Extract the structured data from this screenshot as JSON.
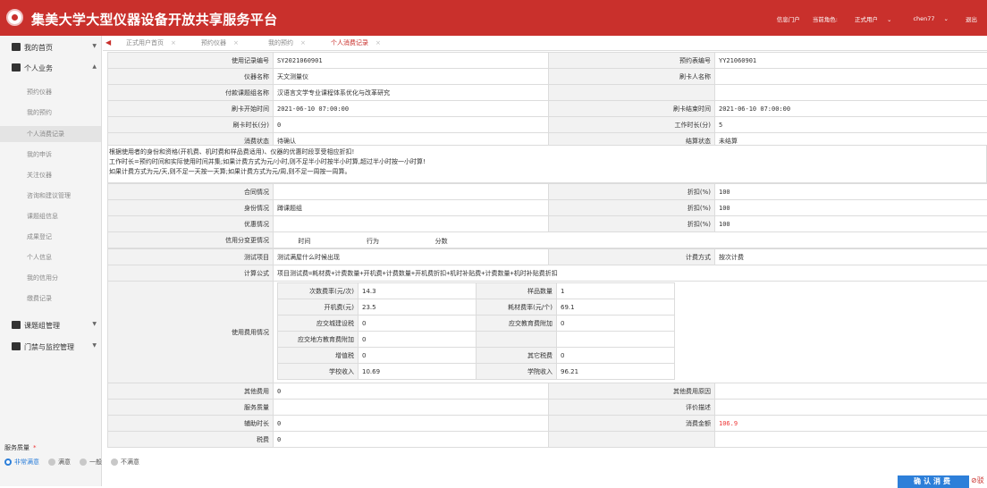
{
  "app": {
    "title": "集美大学大型仪器设备开放共享服务平台"
  },
  "topnav": {
    "portal": "信息门户",
    "role_label": "当前角色:",
    "role": "正式用户",
    "user": "chen77",
    "logout": "退出"
  },
  "sidebar": {
    "home": "我的首页",
    "personal": "个人业务",
    "personal_items": [
      "预约仪器",
      "我的预约",
      "个人消费记录",
      "我的申诉",
      "关注仪器",
      "咨询和建议管理",
      "课题组信息",
      "成果登记",
      "个人信息",
      "我的信用分",
      "缴费记录"
    ],
    "group": "课题组管理",
    "access": "门禁与监控管理"
  },
  "tabs": [
    "正式用户首页",
    "预约仪器",
    "我的预约",
    "个人消费记录"
  ],
  "record": {
    "rows": [
      {
        "l1": "使用记录编号",
        "v1": "SY2021060901",
        "l2": "预约表编号",
        "v2": "YY21060901"
      },
      {
        "l1": "仪器名称",
        "v1": "天文测量仪",
        "l2": "刷卡人名称",
        "v2": ""
      },
      {
        "l1": "付款课题组名称",
        "v1": "汉语言文学专业课程体系优化与改革研究",
        "l2": "",
        "v2": ""
      },
      {
        "l1": "刷卡开始时间",
        "v1": "2021-06-10 07:00:00",
        "l2": "刷卡结束时间",
        "v2": "2021-06-10 07:00:00"
      },
      {
        "l1": "刷卡时长(分)",
        "v1": "0",
        "l2": "工作时长(分)",
        "v2": "5"
      },
      {
        "l1": "消费状态",
        "v1": "待确认",
        "l2": "结算状态",
        "v2": "未结算"
      }
    ],
    "notes": [
      "根据使用者的身份和资格(开机费、机时费和样品费适用)、仪器的优惠时段享受相应折扣!",
      "工作时长=预约时间和实际使用时间并集;如果计费方式为元/小时,则不足半小时按半小时算,超过半小时按一小时算!",
      "如果计费方式为元/天,则不足一天按一天算;如果计费方式为元/周,则不足一周按一周算。"
    ],
    "discounts": [
      {
        "l1": "合同情况",
        "v1": "",
        "l2": "折扣(%)",
        "v2": "100"
      },
      {
        "l1": "身份情况",
        "v1": "蹲课题组",
        "l2": "折扣(%)",
        "v2": "100"
      },
      {
        "l1": "优惠情况",
        "v1": "",
        "l2": "折扣(%)",
        "v2": "100"
      }
    ],
    "credit_label": "信用分变更情况",
    "credit_headers": [
      "时间",
      "行为",
      "分数"
    ],
    "test_label": "测试项目",
    "test_value": "测试满屋什么时候出现",
    "billing_label": "计费方式",
    "billing_value": "按次计费",
    "formula_label": "计算公式",
    "formula_value": "项目测试费=耗材费+计费数量+开机费+计费数量+开机费折扣+机时补贴费+计费数量+机时补贴费折扣",
    "usage_label": "使用费用情况",
    "fees": [
      {
        "l1": "次数费率(元/次)",
        "v1": "14.3",
        "l2": "样品数量",
        "v2": "1"
      },
      {
        "l1": "开机费(元)",
        "v1": "23.5",
        "l2": "耗材费率(元/个)",
        "v2": "69.1"
      },
      {
        "l1": "应交城建设税",
        "v1": "0",
        "l2": "应交教育费附加",
        "v2": "0"
      },
      {
        "l1": "应交地方教育费附加",
        "v1": "0",
        "l2": "",
        "v2": ""
      },
      {
        "l1": "增值税",
        "v1": "0",
        "l2": "其它税费",
        "v2": "0"
      },
      {
        "l1": "学校收入",
        "v1": "10.69",
        "l2": "学院收入",
        "v2": "96.21"
      }
    ],
    "bottom": [
      {
        "l1": "其他费用",
        "v1": "0",
        "l2": "其他费用原因",
        "v2": ""
      },
      {
        "l1": "服务质量",
        "v1": "",
        "l2": "评价描述",
        "v2": ""
      },
      {
        "l1": "辅助时长",
        "v1": "0",
        "l2": "消费金额",
        "v2": "106.9"
      },
      {
        "l1": "税费",
        "v1": "0",
        "l2": "",
        "v2": ""
      }
    ]
  },
  "feedback": {
    "label": "服务质量",
    "required": "*",
    "options": [
      "非常满意",
      "满意",
      "一般",
      "不满意"
    ]
  },
  "actions": {
    "confirm": "确认消费",
    "cancel": "驳"
  },
  "colors": {
    "brand": "#c9302c",
    "accent": "#2d7fd9",
    "amount": "#e33"
  }
}
